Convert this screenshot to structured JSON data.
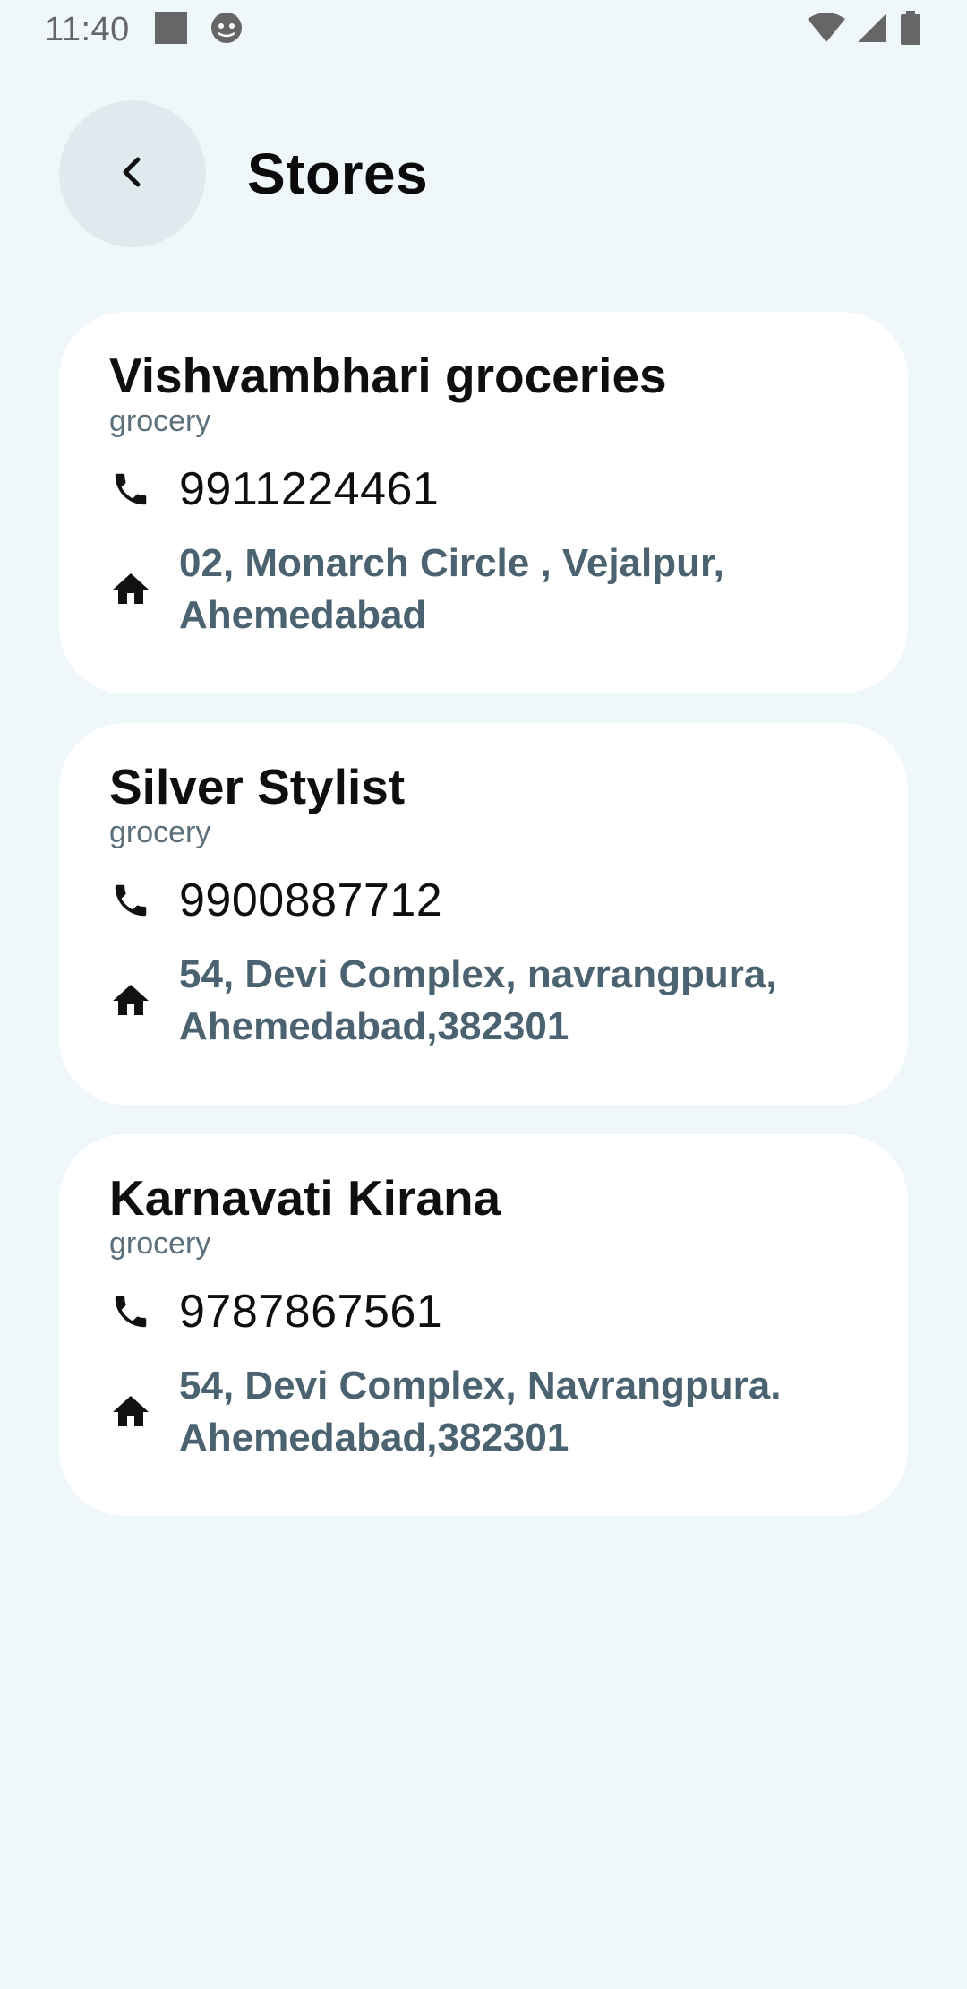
{
  "status_bar": {
    "time": "11:40",
    "icons": [
      "notification-square-icon",
      "android-robot-icon",
      "wifi-icon",
      "cellular-signal-icon",
      "battery-icon"
    ]
  },
  "header": {
    "title": "Stores",
    "back_icon": "chevron-left-icon"
  },
  "stores": [
    {
      "name": "Vishvambhari groceries",
      "category": "grocery",
      "phone": "9911224461",
      "address": "02, Monarch Circle , Vejalpur, Ahemedabad"
    },
    {
      "name": "Silver Stylist",
      "category": "grocery",
      "phone": "9900887712",
      "address": "54, Devi Complex, navrangpura, Ahemedabad,382301"
    },
    {
      "name": "Karnavati Kirana",
      "category": "grocery",
      "phone": "9787867561",
      "address": "54, Devi Complex, Navrangpura. Ahemedabad,382301"
    }
  ],
  "colors": {
    "background": "#eff7fb",
    "card": "#ffffff",
    "back_button": "#dfeaee",
    "address_text": "#4b6270",
    "category_text": "#5b6f7c"
  }
}
